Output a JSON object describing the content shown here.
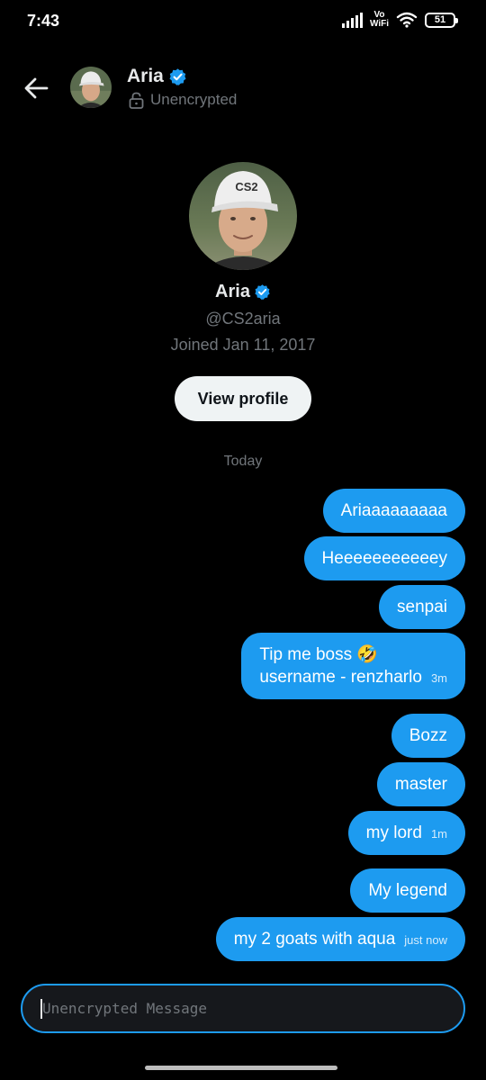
{
  "status_bar": {
    "time": "7:43",
    "network_label": "Vo WiFi",
    "battery": "51"
  },
  "header": {
    "name": "Aria",
    "subtitle": "Unencrypted"
  },
  "profile": {
    "name": "Aria",
    "handle": "@CS2aria",
    "joined": "Joined Jan 11, 2017",
    "view_profile_label": "View profile",
    "cap_text": "CS2"
  },
  "day_separator": "Today",
  "messages": [
    {
      "text": "Ariaaaaaaaaa",
      "time": ""
    },
    {
      "text": "Heeeeeeeeeeey",
      "time": ""
    },
    {
      "text": "senpai",
      "time": ""
    },
    {
      "text": "Tip me boss 🤣",
      "text2": "username - renzharlo",
      "time": "3m"
    },
    {
      "text": "Bozz",
      "time": ""
    },
    {
      "text": "master",
      "time": ""
    },
    {
      "text": "my lord",
      "time": "1m"
    },
    {
      "text": "My legend",
      "time": ""
    },
    {
      "text": "my 2 goats with aqua",
      "time": "just now"
    }
  ],
  "composer": {
    "placeholder": "Unencrypted Message"
  },
  "colors": {
    "accent": "#1d9bf0",
    "background": "#000000",
    "muted": "#71767b"
  }
}
